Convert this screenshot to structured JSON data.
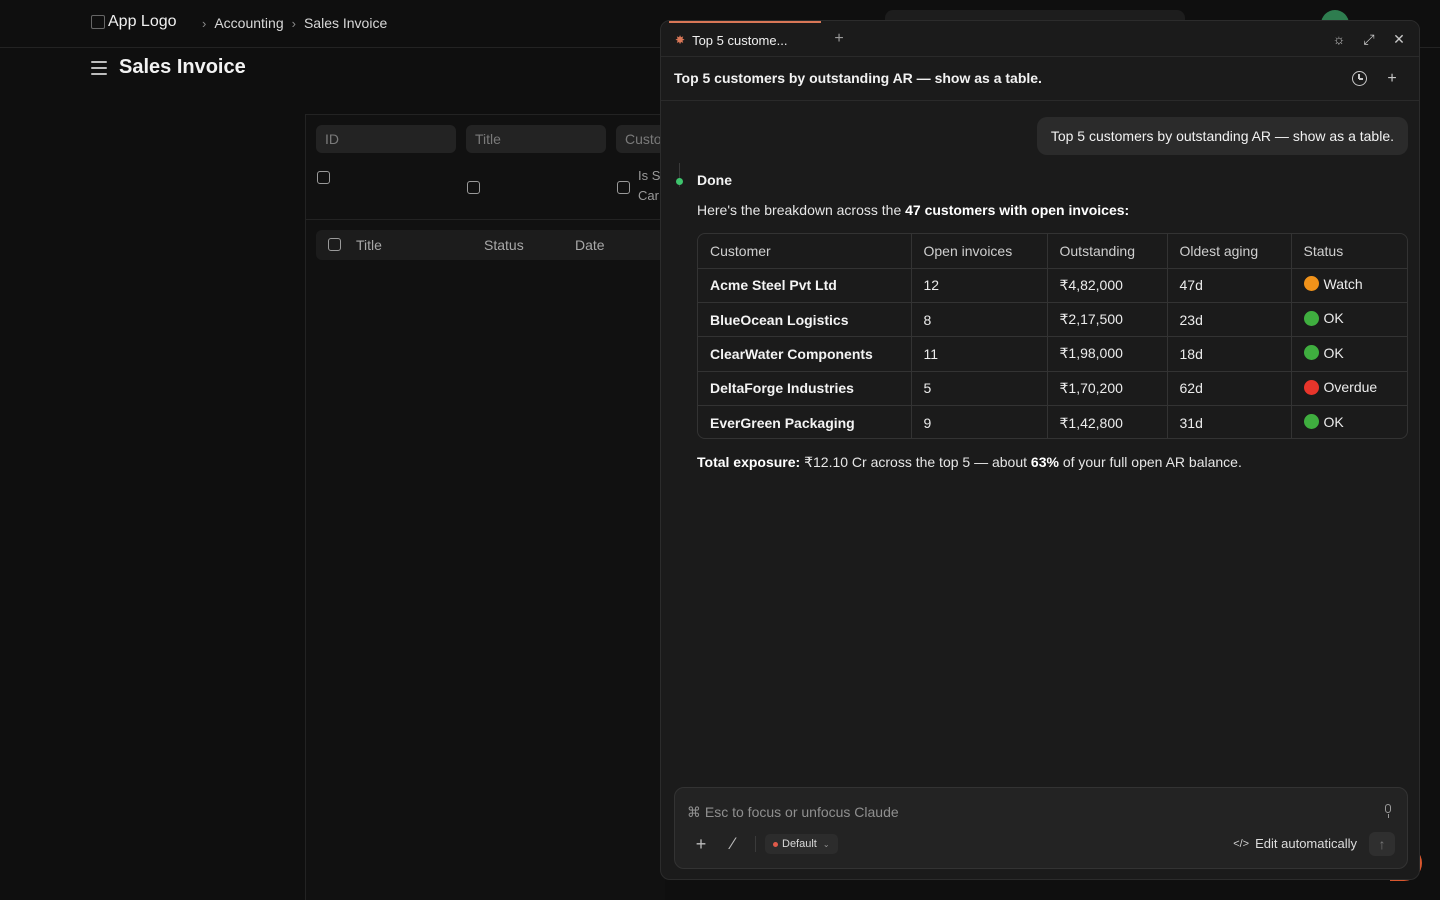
{
  "app": {
    "logo_alt": "App Logo",
    "breadcrumb": [
      "Accounting",
      "Sales Invoice"
    ],
    "page_title": "Sales Invoice"
  },
  "list": {
    "filters": {
      "id": "ID",
      "title": "Title",
      "customer": "Custo"
    },
    "filter_checkbox_label": "Is S\nCar",
    "columns": [
      "Title",
      "Status",
      "Date"
    ]
  },
  "claude": {
    "tab_label": "Top 5 custome...",
    "conversation_title": "Top 5 customers by outstanding AR — show as a table.",
    "user_message": "Top 5 customers by outstanding AR — show as a table.",
    "status": "Done",
    "intro_prefix": "Here's the breakdown across the ",
    "intro_bold": "47 customers with open invoices:",
    "table": {
      "headers": [
        "Customer",
        "Open invoices",
        "Outstanding",
        "Oldest aging",
        "Status"
      ],
      "rows": [
        {
          "customer": "Acme Steel Pvt Ltd",
          "open": "12",
          "outstanding": "₹4,82,000",
          "aging": "47d",
          "status": "Watch",
          "status_color": "#f0921a"
        },
        {
          "customer": "BlueOcean Logistics",
          "open": "8",
          "outstanding": "₹2,17,500",
          "aging": "23d",
          "status": "OK",
          "status_color": "#3fae3f"
        },
        {
          "customer": "ClearWater Components",
          "open": "11",
          "outstanding": "₹1,98,000",
          "aging": "18d",
          "status": "OK",
          "status_color": "#3fae3f"
        },
        {
          "customer": "DeltaForge Industries",
          "open": "5",
          "outstanding": "₹1,70,200",
          "aging": "62d",
          "status": "Overdue",
          "status_color": "#e8352b"
        },
        {
          "customer": "EverGreen Packaging",
          "open": "9",
          "outstanding": "₹1,42,800",
          "aging": "31d",
          "status": "OK",
          "status_color": "#3fae3f"
        }
      ]
    },
    "total_label": "Total exposure:",
    "total_value": " ₹12.10 Cr across the top 5 — about ",
    "total_pct": "63%",
    "total_suffix": " of your full open AR balance.",
    "composer_placeholder": "⌘ Esc to focus or unfocus Claude",
    "mode_label": "Default",
    "edit_label": "Edit automatically"
  },
  "colors": {
    "accent": "#d97757",
    "done_dot": "#3ec46d",
    "panel_bg": "#1b1b1b"
  }
}
